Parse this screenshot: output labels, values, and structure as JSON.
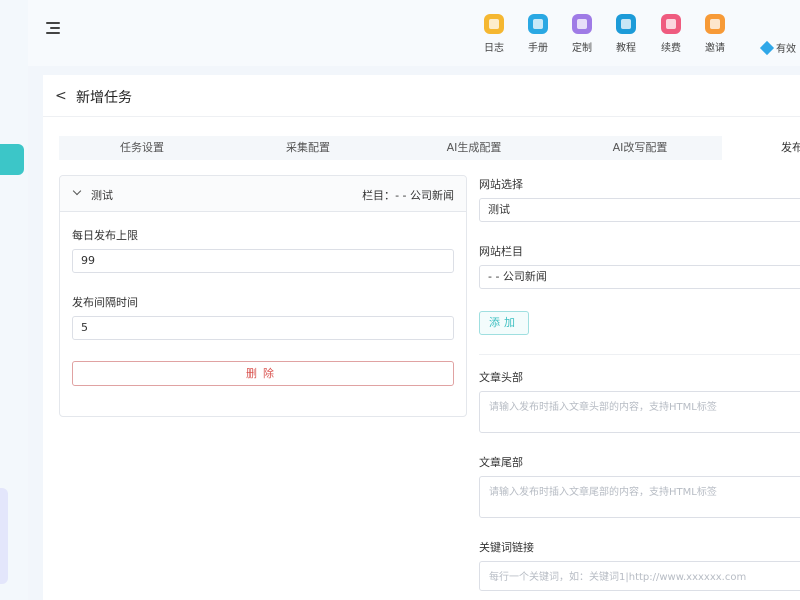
{
  "topbar": {
    "tools": [
      {
        "label": "日志",
        "icon": "log-icon",
        "color": "#f5b731"
      },
      {
        "label": "手册",
        "icon": "manual-icon",
        "color": "#2aa8e3"
      },
      {
        "label": "定制",
        "icon": "customize-icon",
        "color": "#9f7be6"
      },
      {
        "label": "教程",
        "icon": "tutorial-icon",
        "color": "#1d9bd8"
      },
      {
        "label": "续费",
        "icon": "renew-icon",
        "color": "#ef5b7f"
      },
      {
        "label": "邀请",
        "icon": "invite-icon",
        "color": "#f79a37"
      }
    ],
    "validity_label": "有效"
  },
  "header": {
    "back_icon": "<",
    "title": "新增任务"
  },
  "tabs": [
    {
      "label": "任务设置",
      "active": false
    },
    {
      "label": "采集配置",
      "active": false
    },
    {
      "label": "AI生成配置",
      "active": false
    },
    {
      "label": "AI改写配置",
      "active": false
    },
    {
      "label": "发布",
      "active": true
    }
  ],
  "task_panel": {
    "name": "测试",
    "column_label": "栏目：",
    "column_value": "- - 公司新闻",
    "daily_limit_label": "每日发布上限",
    "daily_limit_value": "99",
    "interval_label": "发布间隔时间",
    "interval_value": "5",
    "delete_label": "删除"
  },
  "form": {
    "site_label": "网站选择",
    "site_value": "测试",
    "column_label": "网站栏目",
    "column_value": "- - 公司新闻",
    "add_label": "添加",
    "header_label": "文章头部",
    "header_placeholder": "请输入发布时插入文章头部的内容，支持HTML标签",
    "footer_label": "文章尾部",
    "footer_placeholder": "请输入发布时插入文章尾部的内容，支持HTML标签",
    "keyword_label": "关键词链接",
    "keyword_placeholder": "每行一个关键词，如：关键词1|http://www.xxxxxx.com"
  },
  "colors": {
    "accent": "#3cc6c8",
    "danger": "#d9534f"
  }
}
